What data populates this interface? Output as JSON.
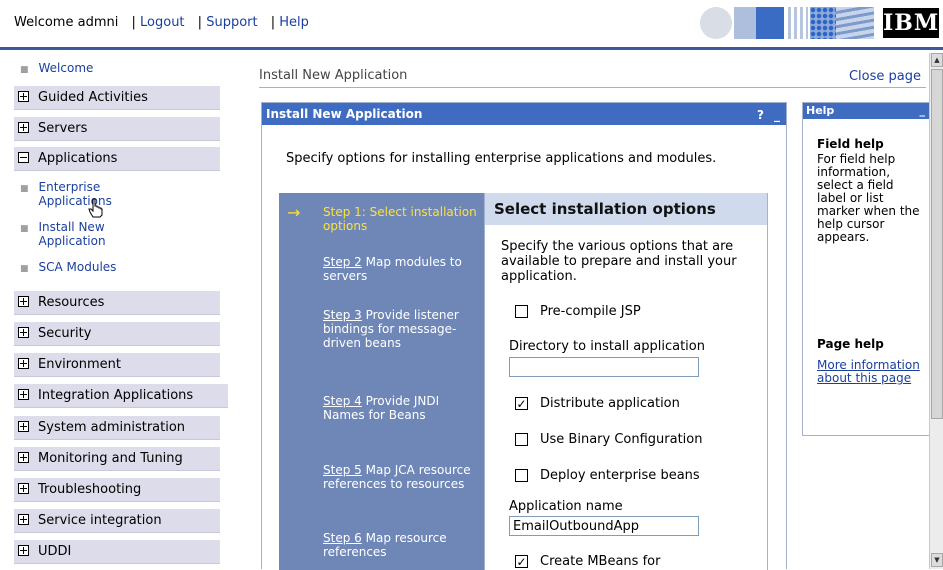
{
  "header": {
    "welcome": "Welcome admni",
    "logout": "Logout",
    "support": "Support",
    "help": "Help",
    "logo": "IBM"
  },
  "leftnav": {
    "welcome": "Welcome",
    "items": [
      {
        "label": "Guided Activities",
        "state": "collapsed"
      },
      {
        "label": "Servers",
        "state": "collapsed"
      },
      {
        "label": "Applications",
        "state": "expanded"
      },
      {
        "label": "Resources",
        "state": "collapsed"
      },
      {
        "label": "Security",
        "state": "collapsed"
      },
      {
        "label": "Environment",
        "state": "collapsed"
      },
      {
        "label": "Integration Applications",
        "state": "collapsed"
      },
      {
        "label": "System administration",
        "state": "collapsed"
      },
      {
        "label": "Monitoring and Tuning",
        "state": "collapsed"
      },
      {
        "label": "Troubleshooting",
        "state": "collapsed"
      },
      {
        "label": "Service integration",
        "state": "collapsed"
      },
      {
        "label": "UDDI",
        "state": "collapsed"
      }
    ],
    "applications_sub": [
      "Enterprise Applications",
      "Install New Application",
      "SCA Modules"
    ]
  },
  "main": {
    "breadcrumb": "Install New Application",
    "close_page": "Close page",
    "panel_title": "Install New Application",
    "panel_help_btn": "?",
    "panel_min_btn": "_",
    "intro": "Specify options for installing enterprise applications and modules.",
    "steps": [
      {
        "num": "Step 1:",
        "text": "Select installation options",
        "active": true
      },
      {
        "num": "Step 2",
        "text": "Map modules to servers",
        "active": false
      },
      {
        "num": "Step 3",
        "text": "Provide listener bindings for message-driven beans",
        "active": false
      },
      {
        "num": "Step 4",
        "text": "Provide JNDI Names for Beans",
        "active": false
      },
      {
        "num": "Step 5",
        "text": "Map JCA resource references to resources",
        "active": false
      },
      {
        "num": "Step 6",
        "text": "Map resource references",
        "active": false
      }
    ],
    "options_title": "Select installation options",
    "options_desc": "Specify the various options that are available to prepare and install your application.",
    "precompile_jsp": {
      "label": "Pre-compile JSP",
      "checked": false
    },
    "directory_label": "Directory to install application",
    "directory_value": "",
    "distribute": {
      "label": "Distribute application",
      "checked": true
    },
    "binary_config": {
      "label": "Use Binary Configuration",
      "checked": false
    },
    "deploy_ejb": {
      "label": "Deploy enterprise beans",
      "checked": false
    },
    "app_name_label": "Application name",
    "app_name_value": "EmailOutboundApp",
    "create_mbeans": {
      "label": "Create MBeans for",
      "checked": true
    }
  },
  "help_portlet": {
    "title": "Help",
    "min_btn": "_",
    "field_help_title": "Field help",
    "field_help_text": "For field help information, select a field label or list marker when the help cursor appears.",
    "page_help_title": "Page help",
    "page_help_link": "More information about this page"
  },
  "colors": {
    "accent_blue": "#3f6cc1",
    "steps_bg": "#6f87b7",
    "active_step": "#ffe03a",
    "nav_bg": "#dcdcea",
    "link": "#1a3fa0"
  }
}
